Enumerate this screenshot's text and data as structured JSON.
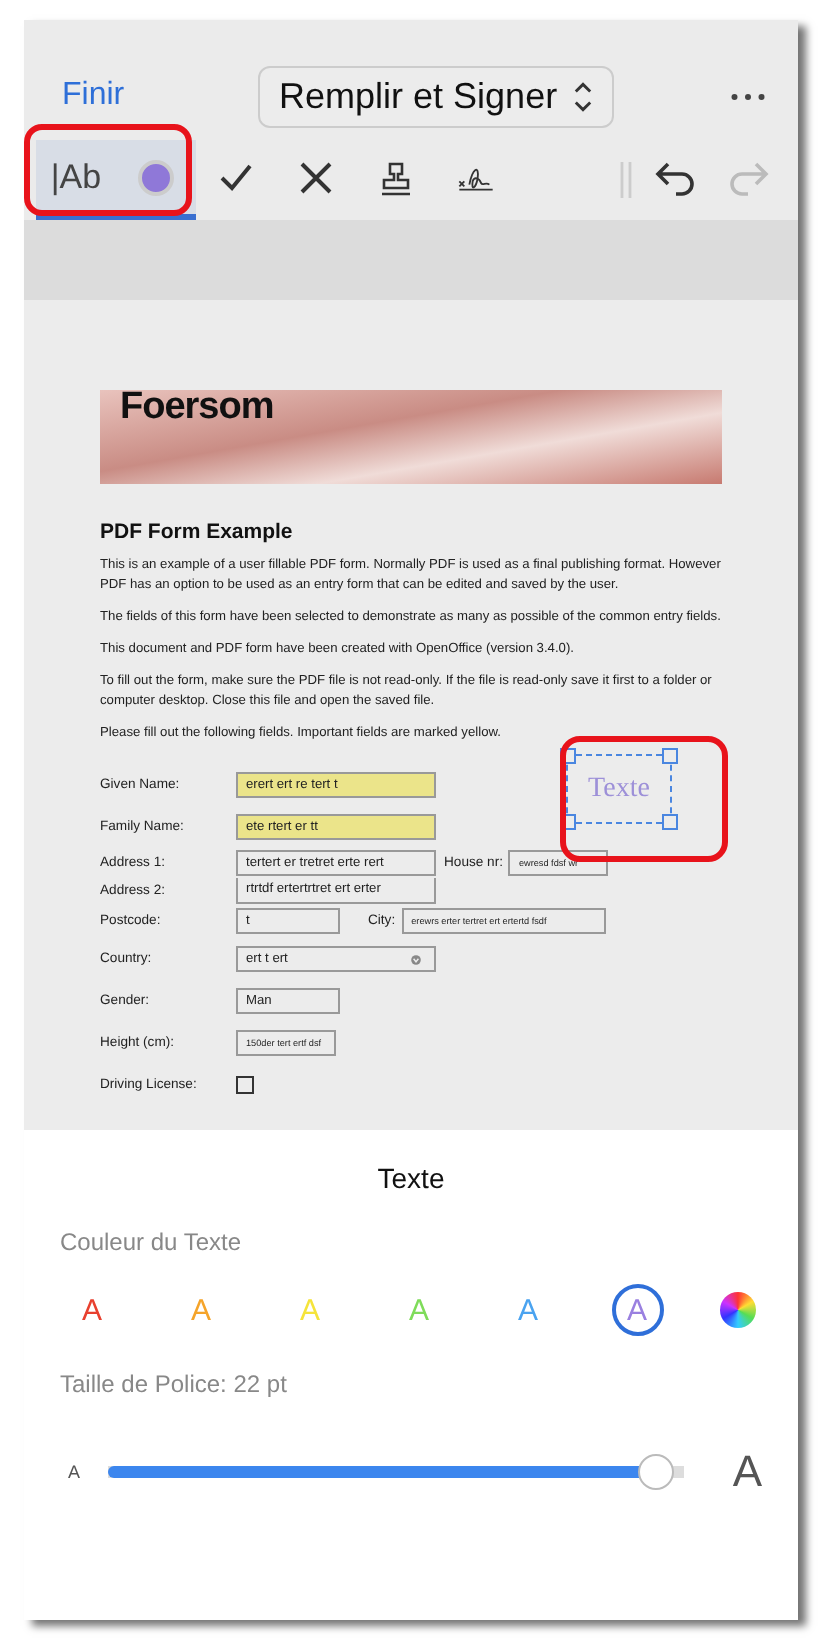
{
  "nav": {
    "done": "Finir",
    "mode": "Remplir et Signer"
  },
  "text_tool": {
    "label": "|Ab",
    "selected": true
  },
  "tools": [
    {
      "kind": "check"
    },
    {
      "kind": "cross"
    },
    {
      "kind": "stamp"
    },
    {
      "kind": "signature"
    }
  ],
  "history": [
    {
      "kind": "undo",
      "disabled": false
    },
    {
      "kind": "redo",
      "disabled": true
    }
  ],
  "document": {
    "logo": "Foersom",
    "title": "PDF Form Example",
    "paragraphs": [
      "This is an example of a user fillable PDF form. Normally PDF is used as a final publishing format. However PDF has an option to be used as an entry form that can be edited and saved by the user.",
      "The fields of this form have been selected to demonstrate as many as possible of the common entry fields.",
      "This document and PDF form have been created with OpenOffice (version 3.4.0).",
      "To fill out the form, make sure the PDF file is not read-only. If the file is read-only save it first to a folder or computer desktop. Close this file and open the saved file.",
      "Please fill out the following fields. Important fields are marked yellow."
    ],
    "rows": [
      {
        "label": "Given Name:",
        "fields": [
          {
            "kind": "required",
            "value": "erert ert re tert t"
          }
        ]
      },
      {
        "label": "Family Name:",
        "fields": [
          {
            "kind": "required",
            "value": "ete rtert er tt"
          }
        ]
      },
      {
        "label": "Address 1:",
        "fields": [
          {
            "kind": "text",
            "value": "tertert er tretret  erte rert"
          },
          {
            "kind": "label",
            "value": "House nr:"
          },
          {
            "kind": "compact",
            "value": "ewresd fdsf wr"
          }
        ]
      },
      {
        "label": "Address 2:",
        "fields": [
          {
            "kind": "text",
            "value": "rtrtdf ertertrtret ert erter"
          }
        ]
      },
      {
        "label": "Postcode:",
        "fields": [
          {
            "kind": "short",
            "value": "t"
          },
          {
            "kind": "label",
            "value": "City:"
          },
          {
            "kind": "wide-compact",
            "value": "erewrs erter tertret ert ertertd fsdf"
          }
        ]
      },
      {
        "label": "Country:",
        "fields": [
          {
            "kind": "select",
            "value": "ert t ert"
          }
        ]
      },
      {
        "label": "Gender:",
        "fields": [
          {
            "kind": "short",
            "value": "Man"
          }
        ]
      },
      {
        "label": "Height (cm):",
        "fields": [
          {
            "kind": "compact",
            "value": "150der tert ertf dsf"
          }
        ]
      },
      {
        "label": "Driving License:",
        "fields": [
          {
            "kind": "checkbox",
            "checked": false
          }
        ]
      }
    ],
    "text_box": {
      "value": "Texte",
      "selected": true
    }
  },
  "sheet": {
    "title": "Texte",
    "color_label": "Couleur du Texte",
    "colors": [
      {
        "kind": "swatch",
        "letter": "A",
        "color": "#e8402f",
        "selected": false
      },
      {
        "kind": "swatch",
        "letter": "A",
        "color": "#f5a42a",
        "selected": false
      },
      {
        "kind": "swatch",
        "letter": "A",
        "color": "#f5e43a",
        "selected": false
      },
      {
        "kind": "swatch",
        "letter": "A",
        "color": "#7fdc5a",
        "selected": false
      },
      {
        "kind": "swatch",
        "letter": "A",
        "color": "#4aa3f0",
        "selected": false
      },
      {
        "kind": "swatch",
        "letter": "A",
        "color": "#9a80e0",
        "selected": true
      },
      {
        "kind": "wheel",
        "selected": false
      }
    ],
    "size_label": "Taille de Police: 22 pt",
    "size_small": "A",
    "size_large": "A",
    "level": 0.98
  }
}
